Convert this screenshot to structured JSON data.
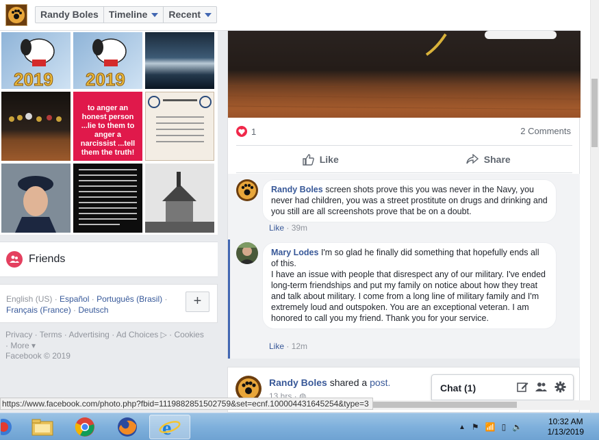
{
  "topbar": {
    "name": "Randy Boles",
    "timeline": "Timeline",
    "recent": "Recent"
  },
  "photos": {
    "tile5_text": "to anger an honest person ...lie to them to anger a narcissist ...tell them the truth!",
    "tile1_year": "2019",
    "tile2_year": "2019"
  },
  "friends": {
    "label": "Friends"
  },
  "languages": {
    "current": "English (US)",
    "sep": " · ",
    "items": [
      "Español",
      "Português (Brasil)",
      "Français (France)",
      "Deutsch"
    ],
    "add": "+"
  },
  "footer": {
    "links": [
      "Privacy",
      "Terms",
      "Advertising",
      "Ad Choices",
      "Cookies",
      "More"
    ],
    "copyright": "Facebook © 2019"
  },
  "post": {
    "reaction_count": "1",
    "comments_count": "2 Comments",
    "like_label": "Like",
    "share_label": "Share"
  },
  "comments": [
    {
      "author": "Randy Boles",
      "text": " screen shots prove this you was never in the Navy, you never had children, you was a street prostitute on drugs and drinking and you still are all screenshots prove that be on a doubt.",
      "like": "Like",
      "time": "39m"
    },
    {
      "author": "Mary Lodes",
      "text": " I'm so glad he finally did something that hopefully ends all of this.",
      "text2": "I have an issue with people that disrespect any of our military. I've ended long-term friendships and put my family on notice about how they treat and talk about military. I come from a long line of military family and I'm extremely loud and outspoken. You are an exceptional veteran. I am honored to call you my friend. Thank you for your service.",
      "like": "Like",
      "time": "12m"
    }
  ],
  "post2": {
    "author": "Randy Boles",
    "verb": " shared a ",
    "link": "post.",
    "time": "13 hrs ·"
  },
  "chat": {
    "label": "Chat (1)"
  },
  "statusbar": {
    "url": "https://www.facebook.com/photo.php?fbid=1119882851502759&set=ecnf.100004431645254&type=3"
  },
  "clock": {
    "time": "10:32 AM",
    "date": "1/13/2019"
  },
  "colors": {
    "facebook_blue": "#385898",
    "link_blue": "#365899",
    "heart_red": "#f0284a",
    "friends_pink": "#e4405f"
  }
}
